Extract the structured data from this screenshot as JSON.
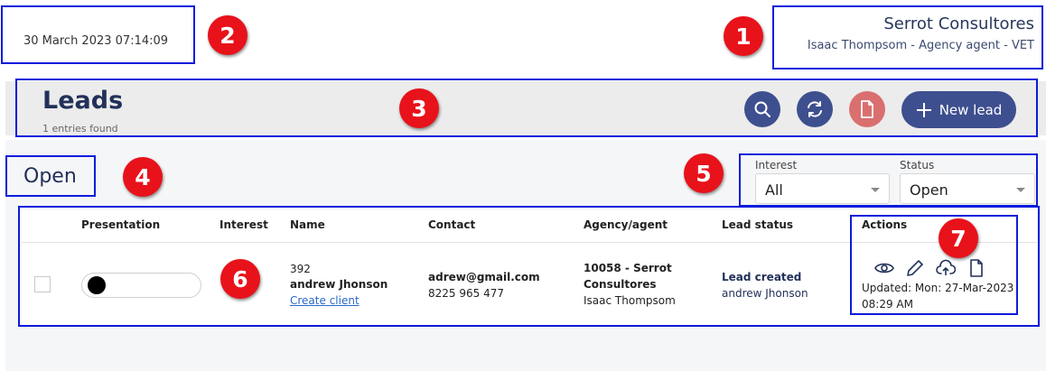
{
  "header": {
    "datetime": "30 March 2023 07:14:09",
    "company": "Serrot Consultores",
    "agent_line": "Isaac Thompsom - Agency agent - VET"
  },
  "leads_bar": {
    "title": "Leads",
    "count": "1 entries found",
    "new_lead_label": "New lead",
    "colors": {
      "search_btn": "#3e4f8f",
      "refresh_btn": "#3e4f8f",
      "pdf_btn": "#d9706f",
      "new_lead_btn": "#3e4f8f"
    }
  },
  "section_title": "Open",
  "filters": {
    "interest": {
      "label": "Interest",
      "value": "All"
    },
    "status": {
      "label": "Status",
      "value": "Open"
    }
  },
  "table": {
    "columns": [
      "Presentation",
      "Interest",
      "Name",
      "Contact",
      "Agency/agent",
      "Lead status",
      "Actions"
    ],
    "rows": [
      {
        "id": "392",
        "name": "andrew Jhonson",
        "create_client": "Create client",
        "email": "adrew@gmail.com",
        "phone": "8225 965 477",
        "agency_line1": "10058 - Serrot",
        "agency_line2": "Consultores",
        "agent": "Isaac Thompsom",
        "lead_status": "Lead created",
        "lead_status_person": "andrew Jhonson",
        "updated_line1": "Updated: Mon: 27-Mar-2023",
        "updated_line2": "08:29 AM",
        "action_icons": [
          "eye-icon",
          "pencil-icon",
          "cloud-upload-icon",
          "document-icon"
        ]
      }
    ]
  },
  "markers": [
    "1",
    "2",
    "3",
    "4",
    "5",
    "6",
    "7"
  ],
  "annotation_color": "#0a1bdc",
  "marker_color": "#e8121b"
}
